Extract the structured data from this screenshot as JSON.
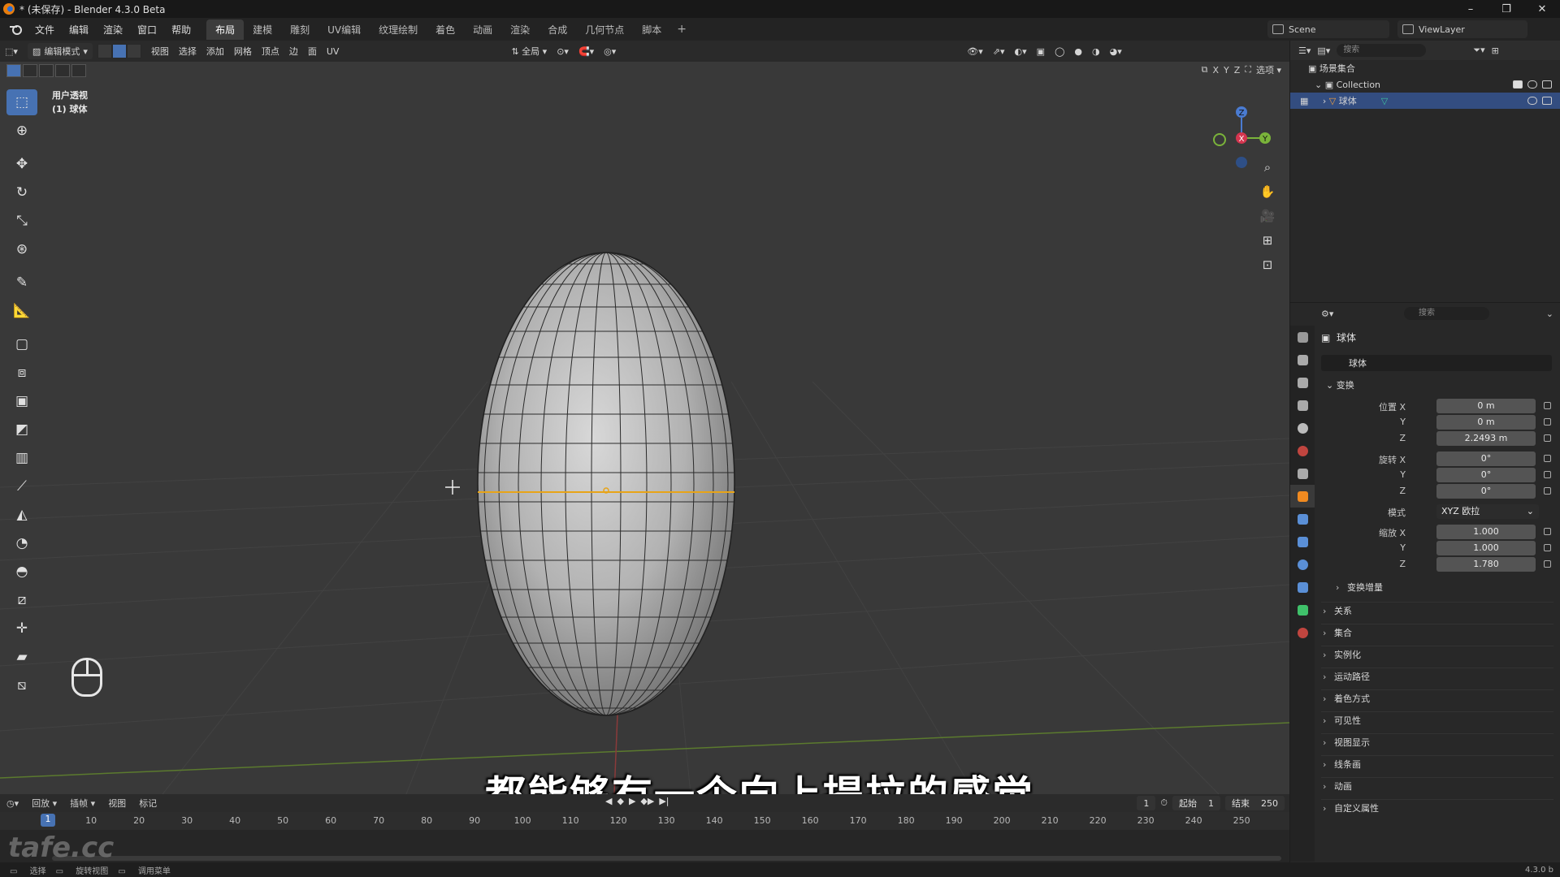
{
  "window": {
    "title": "* (未保存) - Blender 4.3.0 Beta",
    "controls": [
      "–",
      "❐",
      "✕"
    ]
  },
  "menu": {
    "items": [
      "文件",
      "编辑",
      "渲染",
      "窗口",
      "帮助"
    ]
  },
  "workspaces": {
    "tabs": [
      "布局",
      "建模",
      "雕刻",
      "UV编辑",
      "纹理绘制",
      "着色",
      "动画",
      "渲染",
      "合成",
      "几何节点",
      "脚本"
    ],
    "active": 0,
    "add": "+"
  },
  "scene": {
    "name": "Scene",
    "view_layer": "ViewLayer"
  },
  "viewport": {
    "mode": "编辑模式",
    "menus": [
      "视图",
      "选择",
      "添加",
      "网格",
      "顶点",
      "边",
      "面",
      "UV"
    ],
    "transform_orientation": "全局",
    "options": "选项",
    "axes": [
      "X",
      "Y",
      "Z"
    ],
    "view_name": "用户透视",
    "object_label": "(1) 球体",
    "gizmo": {
      "x": "X",
      "y": "Y",
      "z": "Z"
    }
  },
  "subtitle": "都能够有一个向上提拉的感觉",
  "timeline": {
    "menus": [
      "回放",
      "插帧",
      "视图",
      "标记"
    ],
    "current_frame": "1",
    "start_label": "起始",
    "start": "1",
    "end_label": "结束",
    "end": "250",
    "ticks": [
      "10",
      "20",
      "30",
      "40",
      "50",
      "60",
      "70",
      "80",
      "90",
      "100",
      "110",
      "120",
      "130",
      "140",
      "150",
      "160",
      "170",
      "180",
      "190",
      "200",
      "210",
      "220",
      "230",
      "240",
      "250"
    ]
  },
  "status": {
    "items": [
      "选择",
      "旋转视图",
      "调用菜单"
    ],
    "version": "4.3.0 b"
  },
  "watermark": "tafe.cc",
  "outliner": {
    "search_placeholder": "搜索",
    "scene_collection": "场景集合",
    "collection": "Collection",
    "object": "球体"
  },
  "properties": {
    "search_placeholder": "搜索",
    "object_name": "球体",
    "data_name": "球体",
    "transform_title": "变换",
    "location_label": "位置 X",
    "location": [
      "0 m",
      "0 m",
      "2.2493 m"
    ],
    "rotation_label": "旋转 X",
    "rotation": [
      "0°",
      "0°",
      "0°"
    ],
    "mode_label": "模式",
    "mode_value": "XYZ 欧拉",
    "scale_label": "缩放 X",
    "scale": [
      "1.000",
      "1.000",
      "1.780"
    ],
    "y_label": "Y",
    "z_label": "Z",
    "delta": "变换增量",
    "sections": [
      "关系",
      "集合",
      "实例化",
      "运动路径",
      "着色方式",
      "可见性",
      "视图显示",
      "线条画",
      "动画",
      "自定义属性"
    ]
  }
}
